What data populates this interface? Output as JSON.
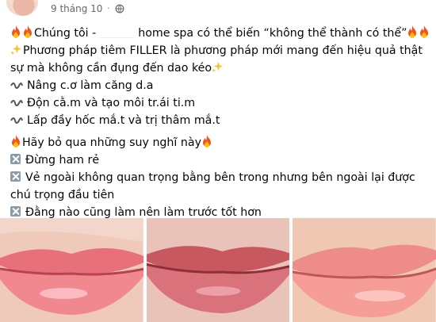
{
  "header": {
    "timestamp": "9 tháng 10",
    "separator": "·",
    "privacy_icon": "globe-icon"
  },
  "post": {
    "line1_pre": "Chúng tôi -",
    "line1_post": "home spa có thể biến “không thể thành có thể”",
    "line2": "Phương pháp tiêm FILLER là phương pháp mới mang đến hiệu quả thật",
    "line3": "sự mà không cần đụng đến dao kéo",
    "bullets_wave": [
      "Nâng c.ơ làm căng d.a",
      "Độn cằ.m và tạo môi tr.ái ti.m",
      "Lấp đầy hốc mắ.t và trị thâm mắ.t"
    ],
    "line_intro": "Hãy bỏ qua những suy nghĩ này",
    "bullets_x": [
      "Đừng ham rẻ",
      "Vẻ ngoài không quan trọng bằng bên trong nhưng bên ngoài lại được chú trọng đầu tiên",
      "Đằng nào cũng làm nên làm trước tốt hơn"
    ]
  },
  "photos": [
    "lip-photo-1",
    "lip-photo-2",
    "lip-photo-3"
  ],
  "colors": {
    "text": "#050505",
    "meta": "#65676b",
    "fire": "#f4511e",
    "sparkle": "#f6c231"
  }
}
